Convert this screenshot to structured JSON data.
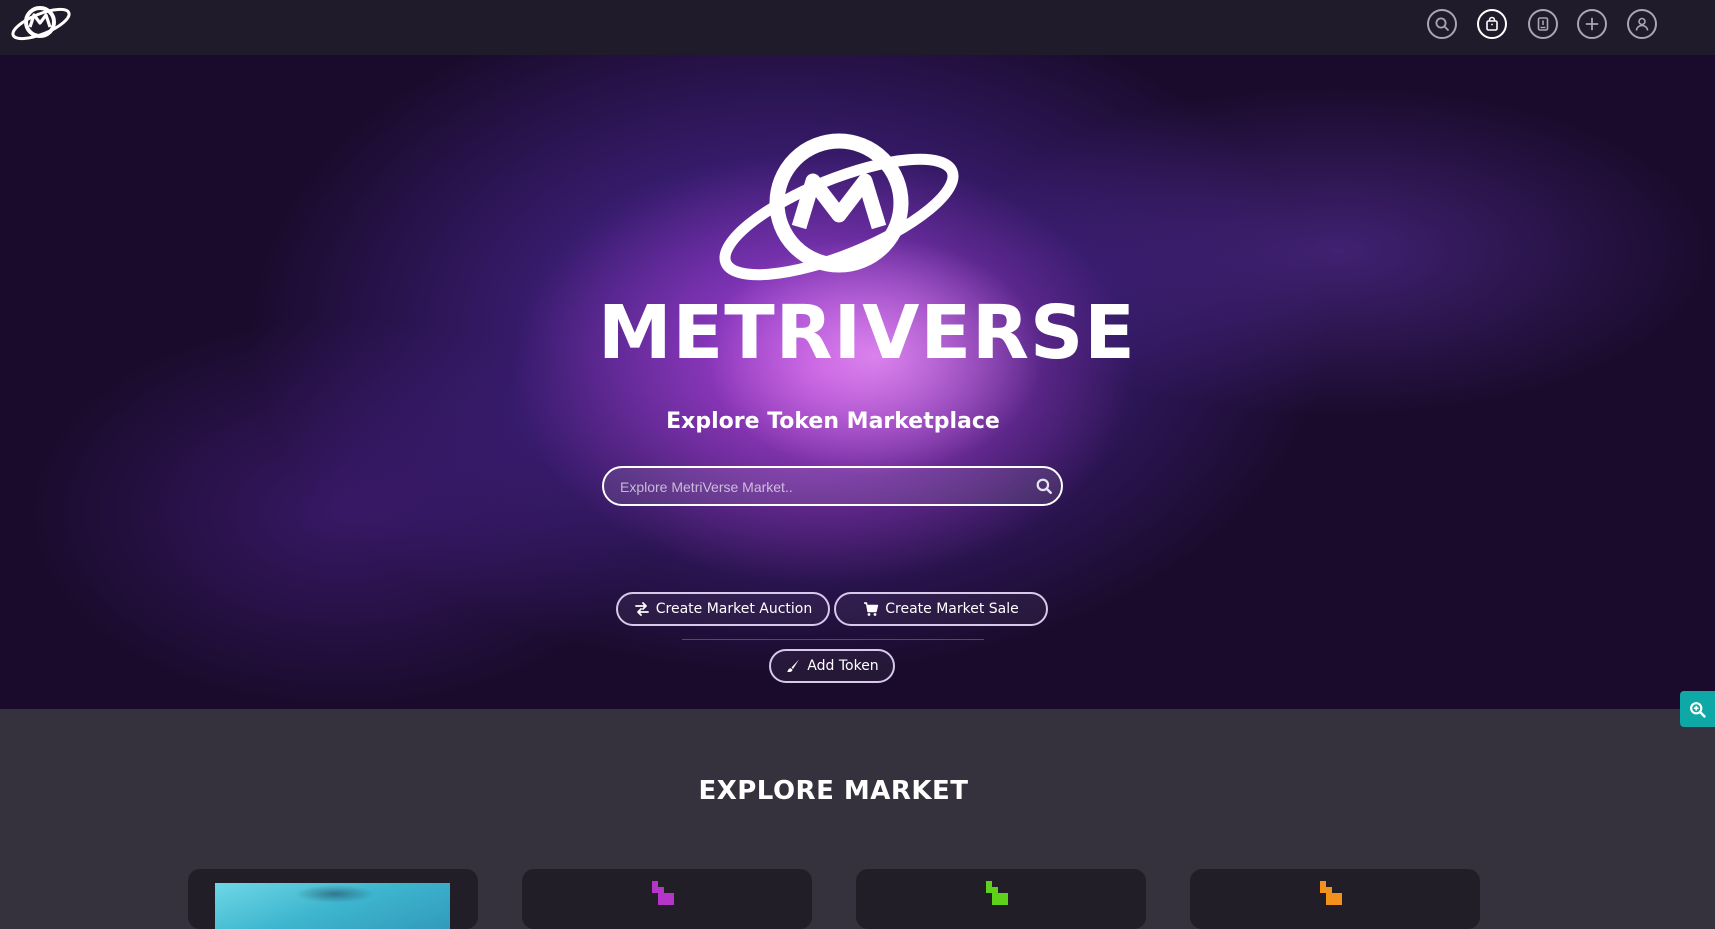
{
  "nav": {
    "brand_icon": "metriverse-planet-logo-icon",
    "icons": [
      "search-icon",
      "shopping-bag-icon",
      "notebook-icon",
      "plus-icon",
      "user-icon"
    ],
    "active_icon": "shopping-bag-icon"
  },
  "hero": {
    "logo_icon": "metriverse-planet-logo-icon",
    "wordmark": "METRIVERSE",
    "subtitle": "Explore Token Marketplace",
    "search": {
      "placeholder": "Explore MetriVerse Market..",
      "value": "",
      "icon": "search-icon"
    },
    "buttons": {
      "auction": {
        "label": "Create Market Auction",
        "icon": "exchange-arrows-icon"
      },
      "sale": {
        "label": "Create Market Sale",
        "icon": "cart-icon"
      },
      "token": {
        "label": "Add Token",
        "icon": "paint-brush-icon"
      }
    }
  },
  "zoom_tab": {
    "icon": "zoom-in-icon"
  },
  "explore": {
    "title": "EXPLORE MARKET",
    "cards": [
      {
        "thumbnail": "underwater-image"
      },
      {
        "thumbnail": "pixel-glyph-icon",
        "color": "#b535c8"
      },
      {
        "thumbnail": "pixel-glyph-icon",
        "color": "#5fd11a"
      },
      {
        "thumbnail": "pixel-glyph-icon",
        "color": "#f2921c"
      }
    ]
  },
  "colors": {
    "nav_bg": "#1f1b2b",
    "page_bg": "#35323d",
    "card_bg": "#211e27",
    "accent_teal": "#0ea9a6"
  }
}
